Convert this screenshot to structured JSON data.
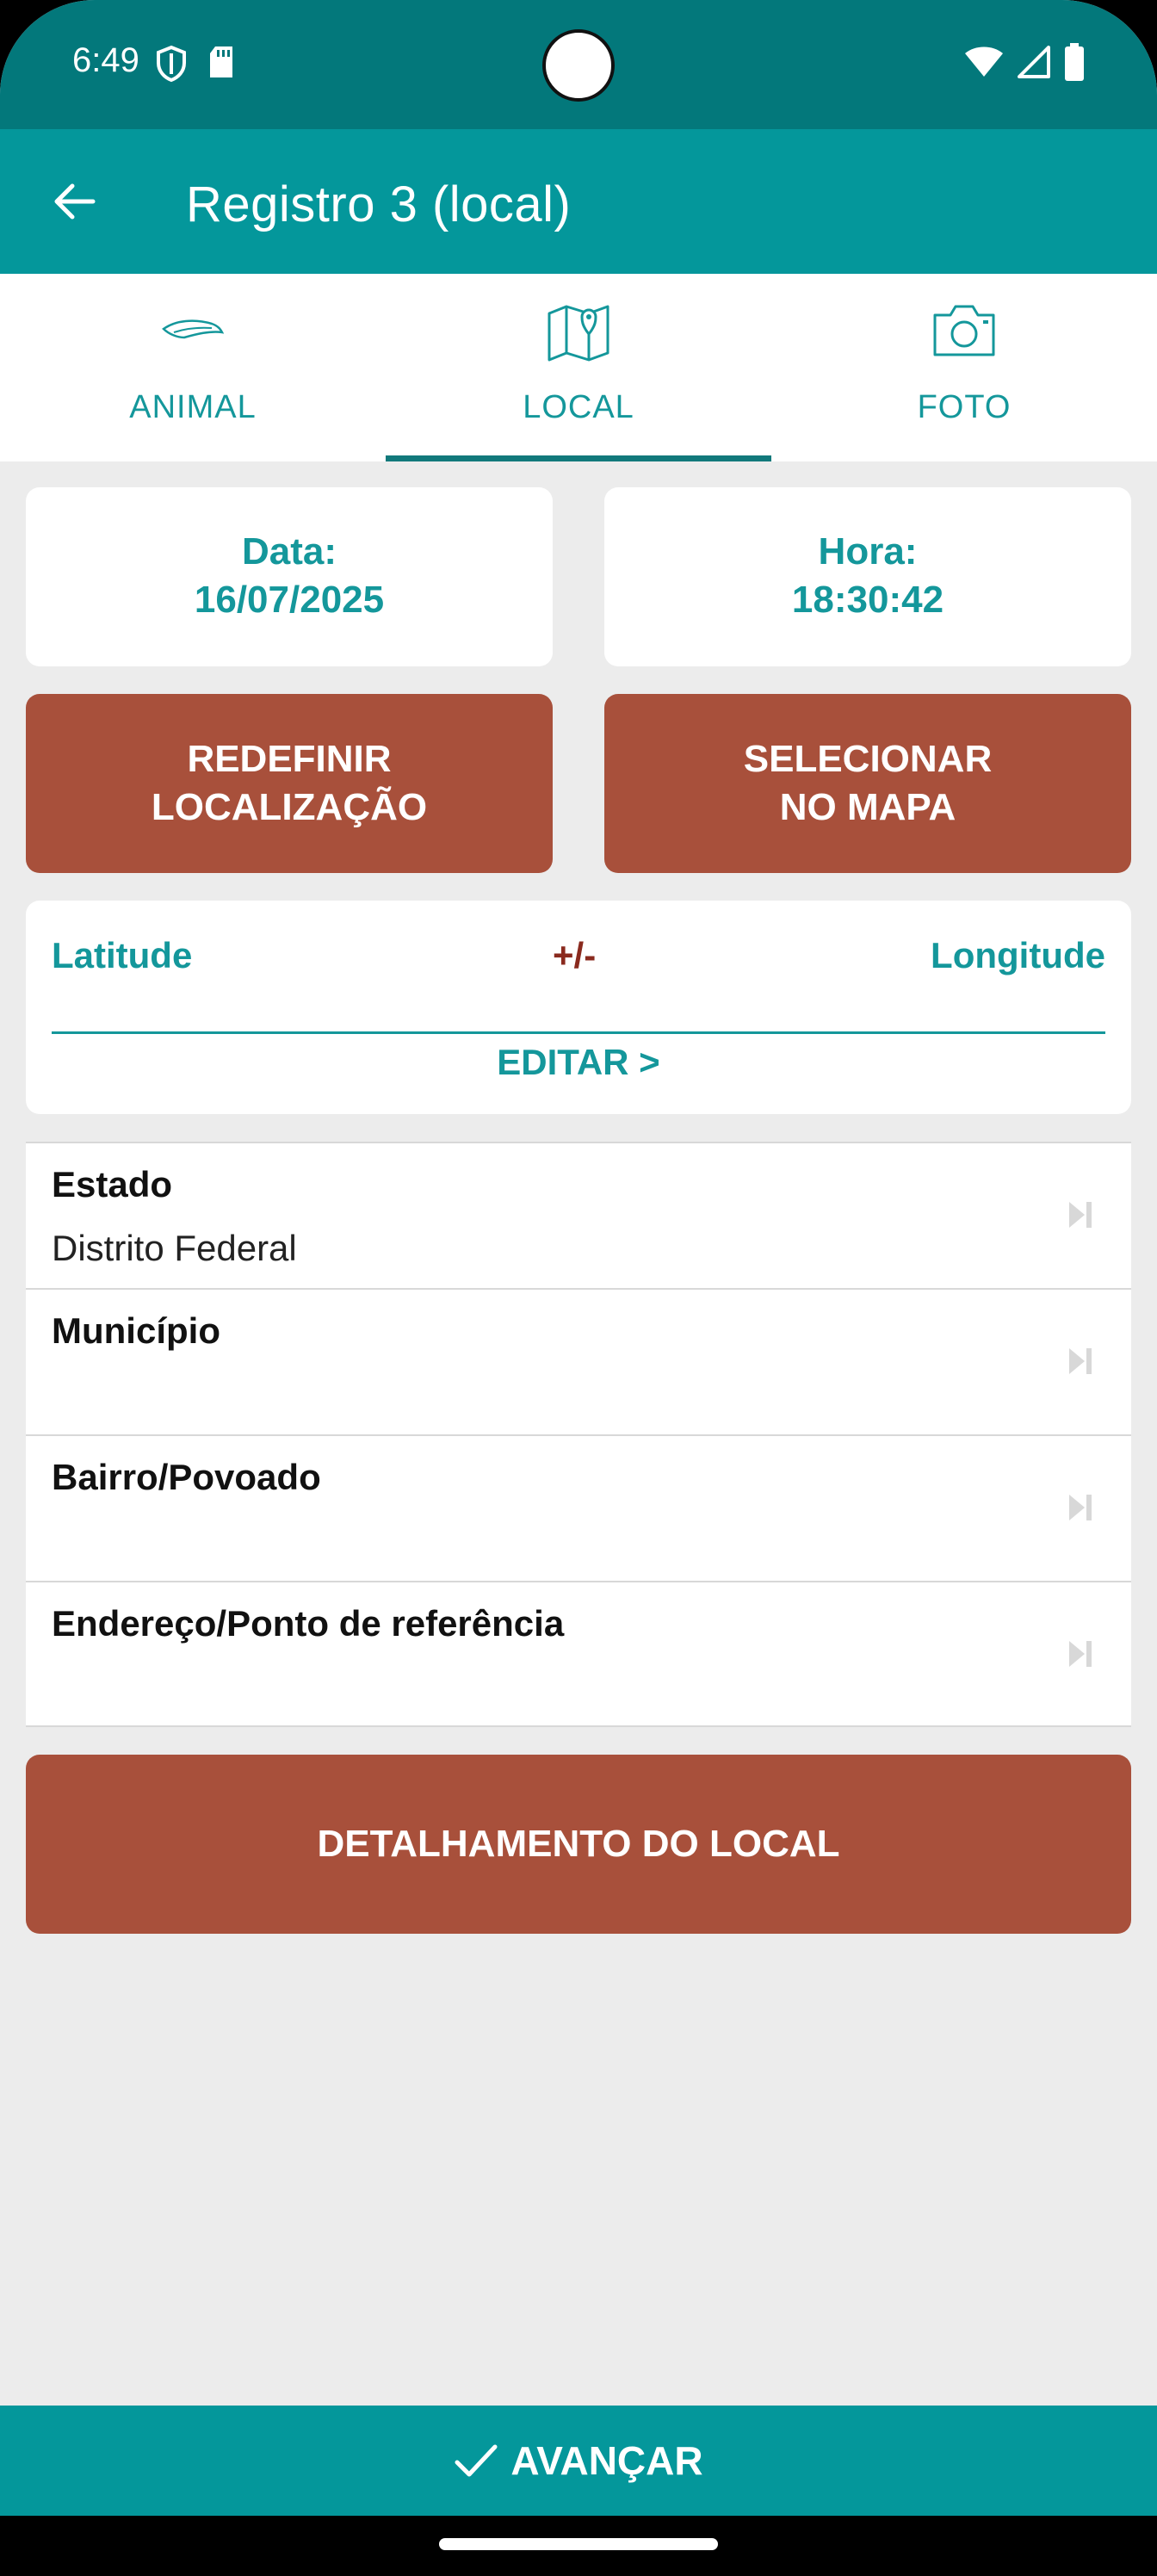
{
  "status_bar": {
    "time": "6:49"
  },
  "app_bar": {
    "title": "Registro 3 (local)"
  },
  "tabs": [
    {
      "label": "ANIMAL",
      "icon": "feather-icon",
      "selected": false
    },
    {
      "label": "LOCAL",
      "icon": "map-pin-icon",
      "selected": true
    },
    {
      "label": "FOTO",
      "icon": "camera-icon",
      "selected": false
    }
  ],
  "date_card": {
    "label": "Data:",
    "value": "16/07/2025"
  },
  "time_card": {
    "label": "Hora:",
    "value": "18:30:42"
  },
  "buttons": {
    "reset_location": {
      "line1": "REDEFINIR",
      "line2": "LOCALIZAÇÃO"
    },
    "select_on_map": {
      "line1": "SELECIONAR",
      "line2": "NO MAPA"
    },
    "location_details": "DETALHAMENTO DO LOCAL",
    "advance": "AVANÇAR"
  },
  "coordinates": {
    "latitude_label": "Latitude",
    "plus_minus_label": "+/-",
    "longitude_label": "Longitude",
    "edit_label": "EDITAR >"
  },
  "fields": [
    {
      "label": "Estado",
      "value": "Distrito Federal"
    },
    {
      "label": "Município",
      "value": ""
    },
    {
      "label": "Bairro/Povoado",
      "value": ""
    },
    {
      "label": "Endereço/Ponto de referência",
      "value": ""
    }
  ],
  "colors": {
    "status_bar": "#03787b",
    "primary": "#04979b",
    "accent_button": "#a8503b",
    "tab_text": "#14979b",
    "plus_minus": "#8a2a1e",
    "background": "#ececec"
  }
}
